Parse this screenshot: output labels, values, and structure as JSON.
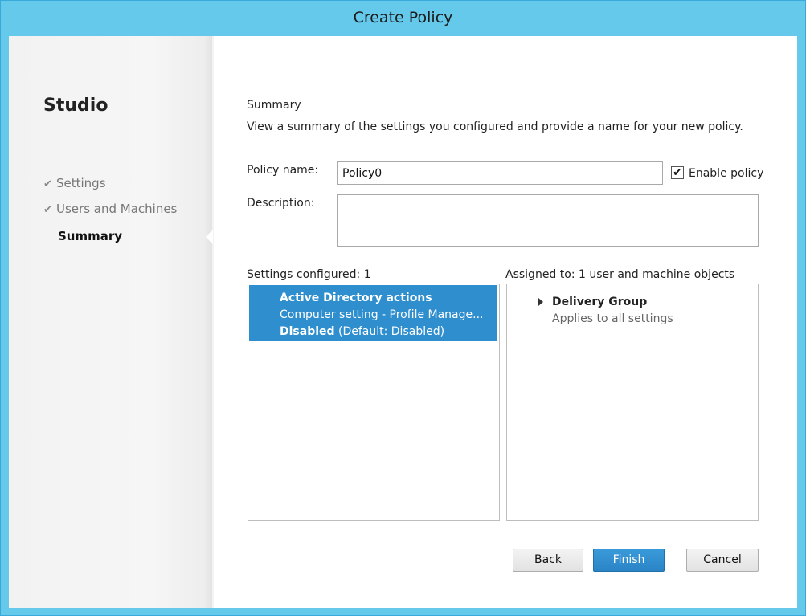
{
  "window": {
    "title": "Create Policy"
  },
  "sidebar": {
    "app_name": "Studio",
    "steps": [
      {
        "label": "Settings",
        "state": "completed"
      },
      {
        "label": "Users and Machines",
        "state": "completed"
      },
      {
        "label": "Summary",
        "state": "current"
      }
    ],
    "check_icon": "✔"
  },
  "main": {
    "heading": "Summary",
    "subheading": "View a summary of the settings you configured and provide a name for your new policy.",
    "policy_name_label": "Policy name:",
    "policy_name_value": "Policy0",
    "enable_policy_label": "Enable policy",
    "enable_policy_checked": true,
    "description_label": "Description:",
    "description_value": "",
    "settings_configured_label": "Settings configured: 1",
    "settings": [
      {
        "name": "Active Directory actions",
        "detail": "Computer setting - Profile Manage...",
        "value_bold": "Disabled",
        "value_rest": " (Default: Disabled)"
      }
    ],
    "assigned_label": "Assigned to: 1 user and machine objects",
    "assignments": [
      {
        "name": "Delivery Group",
        "detail": "Applies to all settings"
      }
    ]
  },
  "buttons": {
    "back": "Back",
    "finish": "Finish",
    "cancel": "Cancel"
  },
  "colors": {
    "titlebar": "#65c9ec",
    "selection": "#2e8ece",
    "primary_button": "#2a84c6"
  }
}
